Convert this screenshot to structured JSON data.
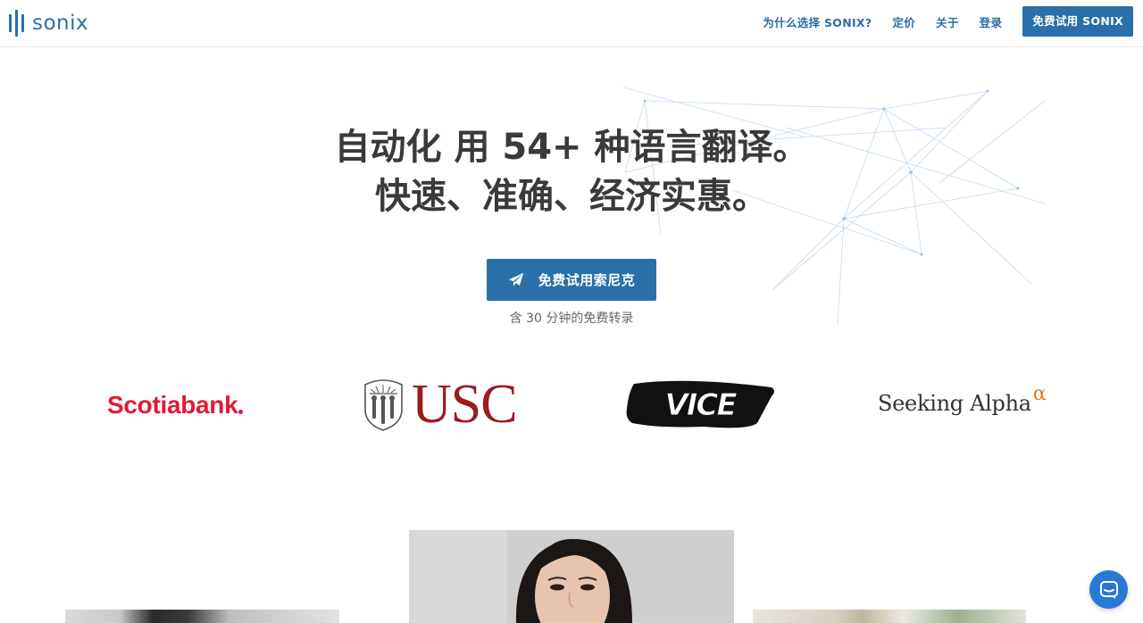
{
  "header": {
    "logo_text": "sonix",
    "nav": [
      {
        "label": "为什么选择 SONIX?"
      },
      {
        "label": "定价"
      },
      {
        "label": "关于"
      },
      {
        "label": "登录"
      }
    ],
    "cta_label": "免费试用 SONIX"
  },
  "hero": {
    "title_line1": "自动化 用 54+ 种语言翻译。",
    "title_line2": "快速、准确、经济实惠。",
    "cta_label": "免费试用索尼克",
    "subtext": "含 30 分钟的免费转录"
  },
  "clients": {
    "scotiabank": "Scotiabank",
    "usc": "USC",
    "vice": "VICE",
    "seeking_alpha": "Seeking Alpha",
    "seeking_alpha_sup": "α"
  },
  "colors": {
    "brand_blue": "#2a6fa8",
    "scotia_red": "#e31837",
    "usc_red": "#9b1b1e",
    "chat_blue": "#2a78d6"
  },
  "icons": {
    "cta": "paper-plane-icon",
    "chat": "chat-icon"
  }
}
